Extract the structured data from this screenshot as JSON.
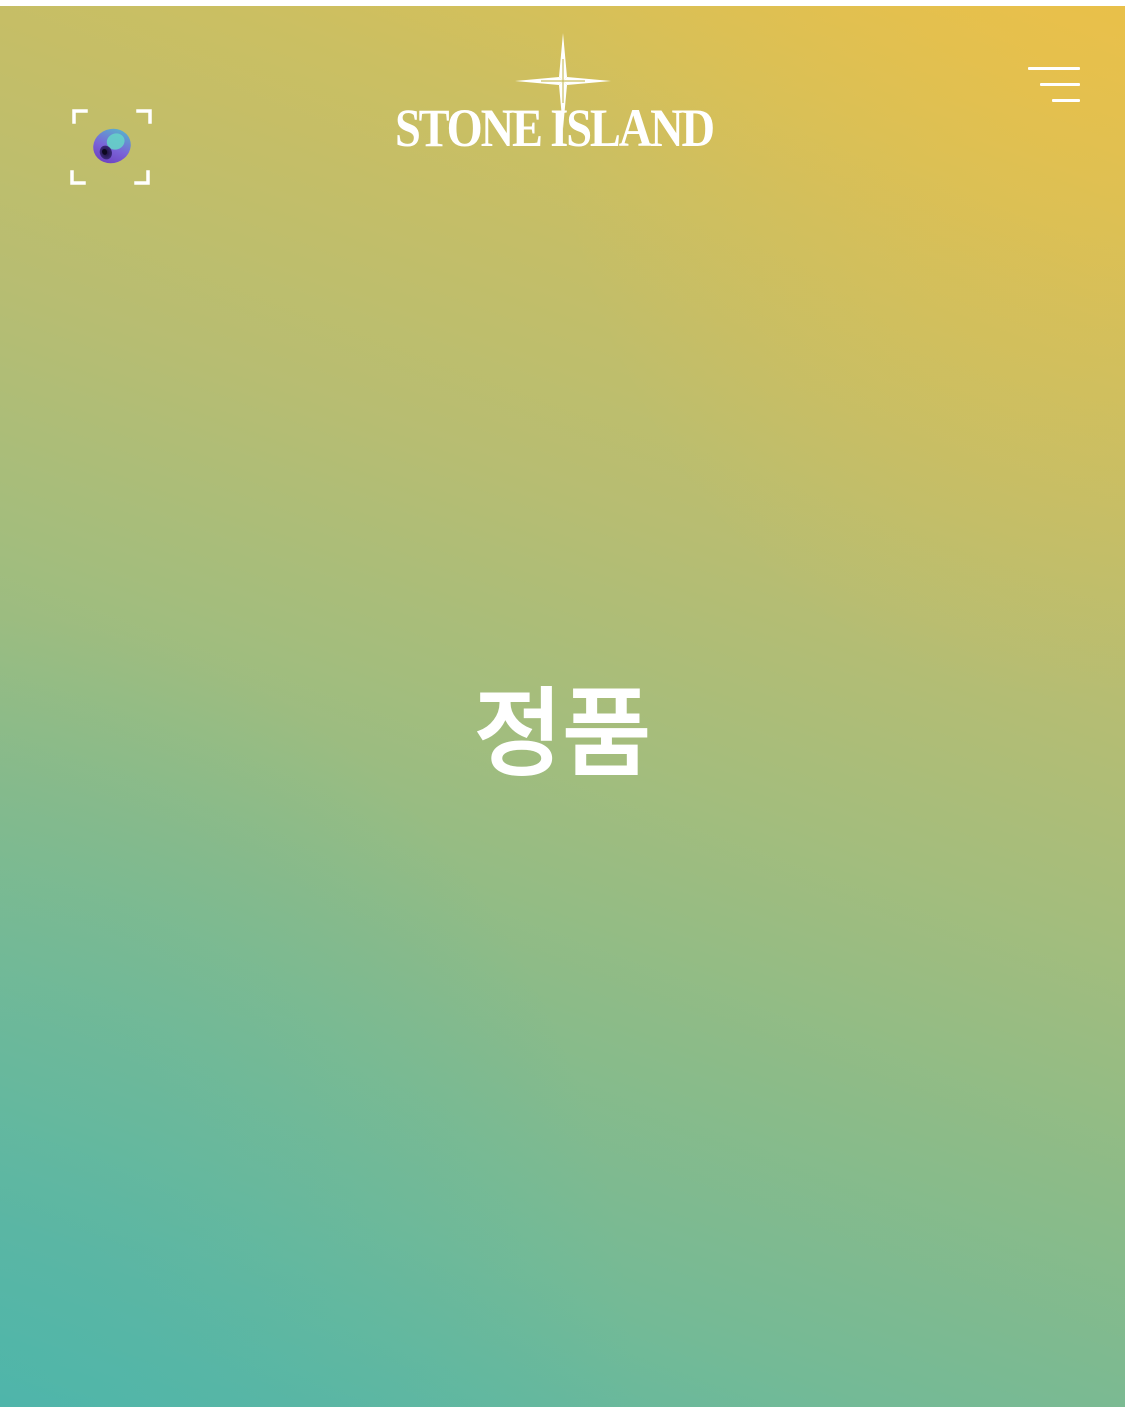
{
  "header": {
    "logo_text": "STONE ISLAND",
    "scan_button_icon": "ar-scan-icon",
    "menu_icon": "hamburger-menu-icon"
  },
  "main": {
    "headline": "정품"
  },
  "colors": {
    "gradient_top": "#e6c14c",
    "gradient_middle": "#a3bd7d",
    "gradient_bottom": "#52b6a8",
    "foreground": "#ffffff",
    "scan_orb_purple": "#6a4fc8",
    "scan_orb_teal": "#4fc3c8"
  }
}
